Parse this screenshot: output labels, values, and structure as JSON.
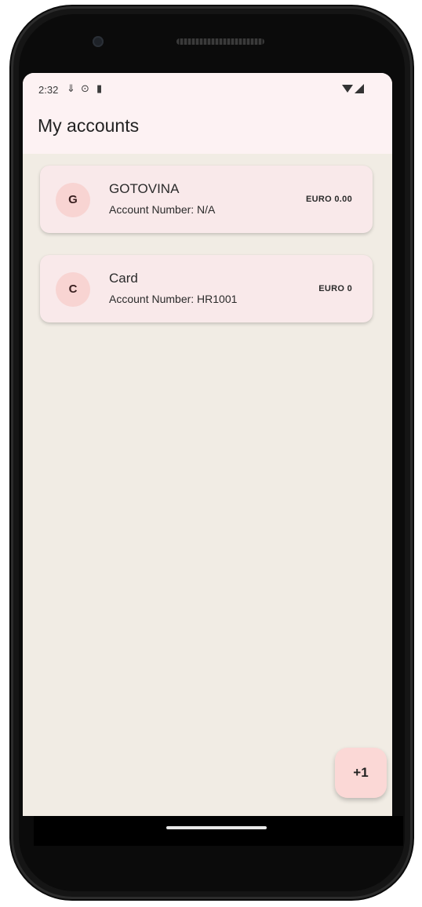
{
  "status_bar": {
    "time": "2:32",
    "icons": [
      "download-icon",
      "sync-icon",
      "clipboard-icon",
      "wifi-icon",
      "signal-icon"
    ]
  },
  "app_bar": {
    "title": "My accounts"
  },
  "accounts": [
    {
      "initial": "G",
      "name": "GOTOVINA",
      "account_number": "Account Number: N/A",
      "balance": "EURO 0.00"
    },
    {
      "initial": "C",
      "name": "Card",
      "account_number": "Account Number: HR1001",
      "balance": "EURO 0"
    }
  ],
  "fab": {
    "label": "+1"
  },
  "colors": {
    "screen_background": "#f1ece4",
    "app_bar_background": "#fdf2f3",
    "card_background": "#f9e9ea",
    "avatar_background": "#f8d4d2",
    "fab_background": "#fbd8d6"
  }
}
